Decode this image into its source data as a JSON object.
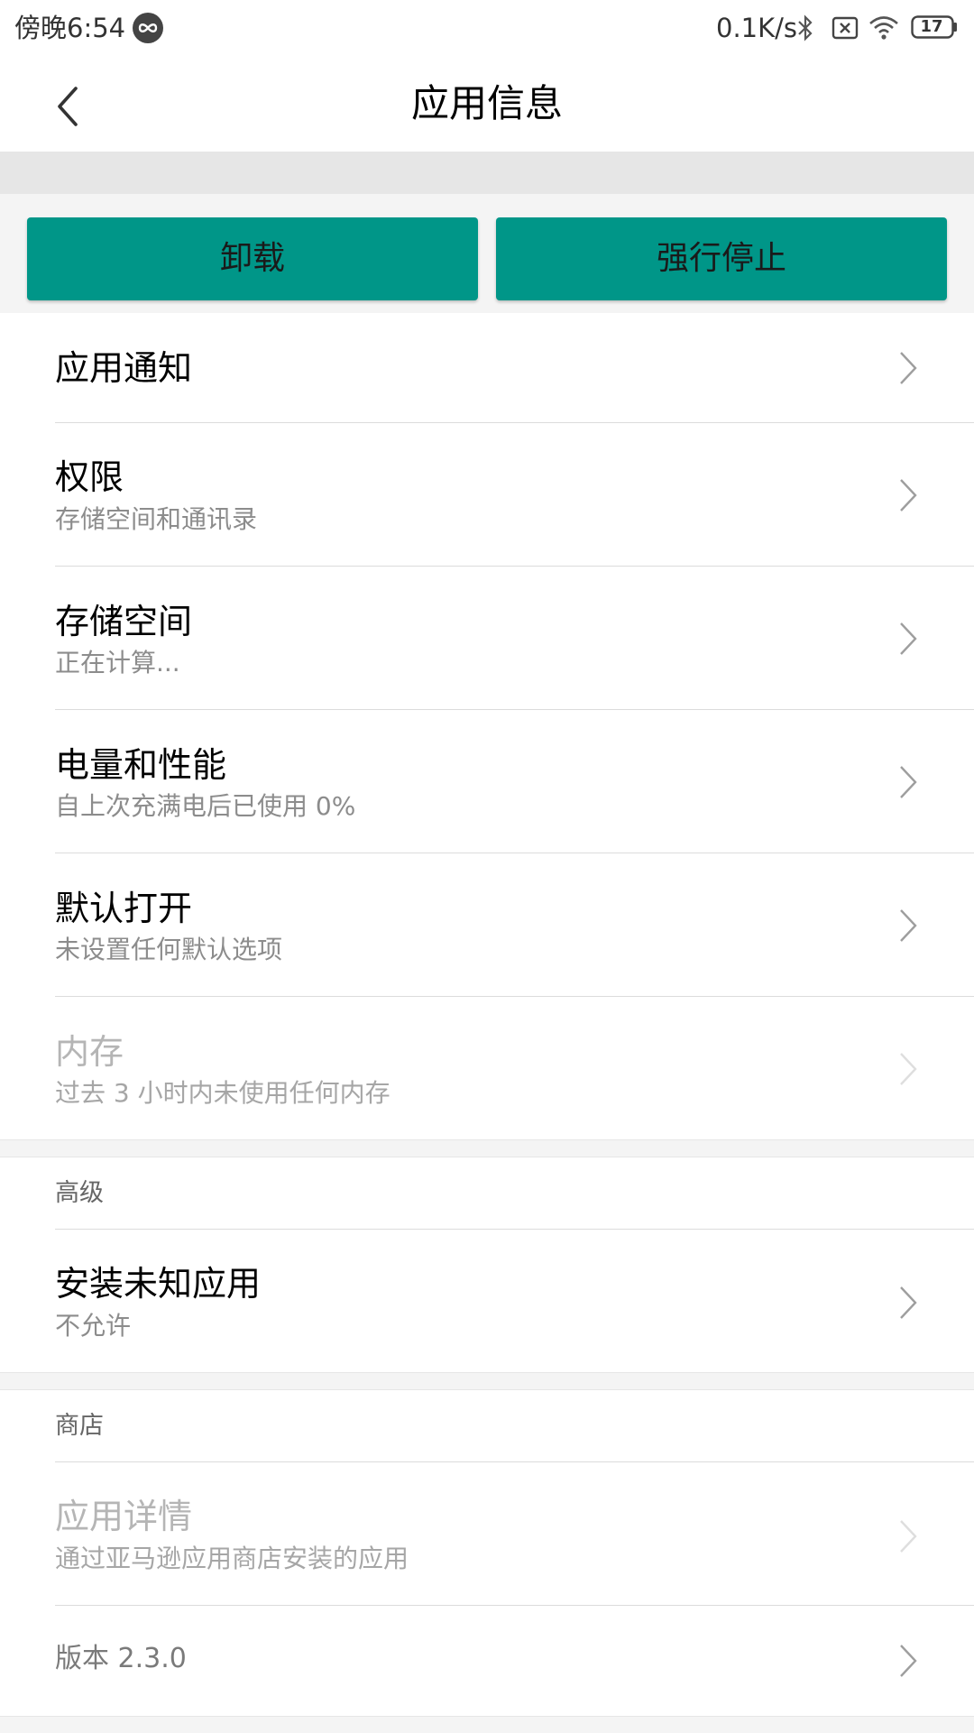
{
  "status_bar": {
    "time": "傍晚6:54",
    "network_speed": "0.1K/s",
    "battery_level": "17",
    "icons": [
      "loop-icon",
      "bluetooth-icon",
      "no-sim-icon",
      "wifi-icon",
      "battery-icon"
    ]
  },
  "header": {
    "title": "应用信息",
    "back_icon": "back-arrow-icon"
  },
  "actions": {
    "uninstall_label": "卸载",
    "force_stop_label": "强行停止",
    "button_color": "#009688"
  },
  "items": [
    {
      "title": "应用通知",
      "subtitle": "",
      "enabled": true
    },
    {
      "title": "权限",
      "subtitle": "存储空间和通讯录",
      "enabled": true
    },
    {
      "title": "存储空间",
      "subtitle": "正在计算...",
      "enabled": true
    },
    {
      "title": "电量和性能",
      "subtitle": "自上次充满电后已使用 0%",
      "enabled": true
    },
    {
      "title": "默认打开",
      "subtitle": "未设置任何默认选项",
      "enabled": true
    },
    {
      "title": "内存",
      "subtitle": "过去 3 小时内未使用任何内存",
      "enabled": false
    }
  ],
  "advanced": {
    "header": "高级",
    "items": [
      {
        "title": "安装未知应用",
        "subtitle": "不允许",
        "enabled": true
      }
    ]
  },
  "store": {
    "header": "商店",
    "items": [
      {
        "title": "应用详情",
        "subtitle": "通过亚马逊应用商店安装的应用",
        "enabled": false
      }
    ]
  },
  "version": "版本 2.3.0"
}
